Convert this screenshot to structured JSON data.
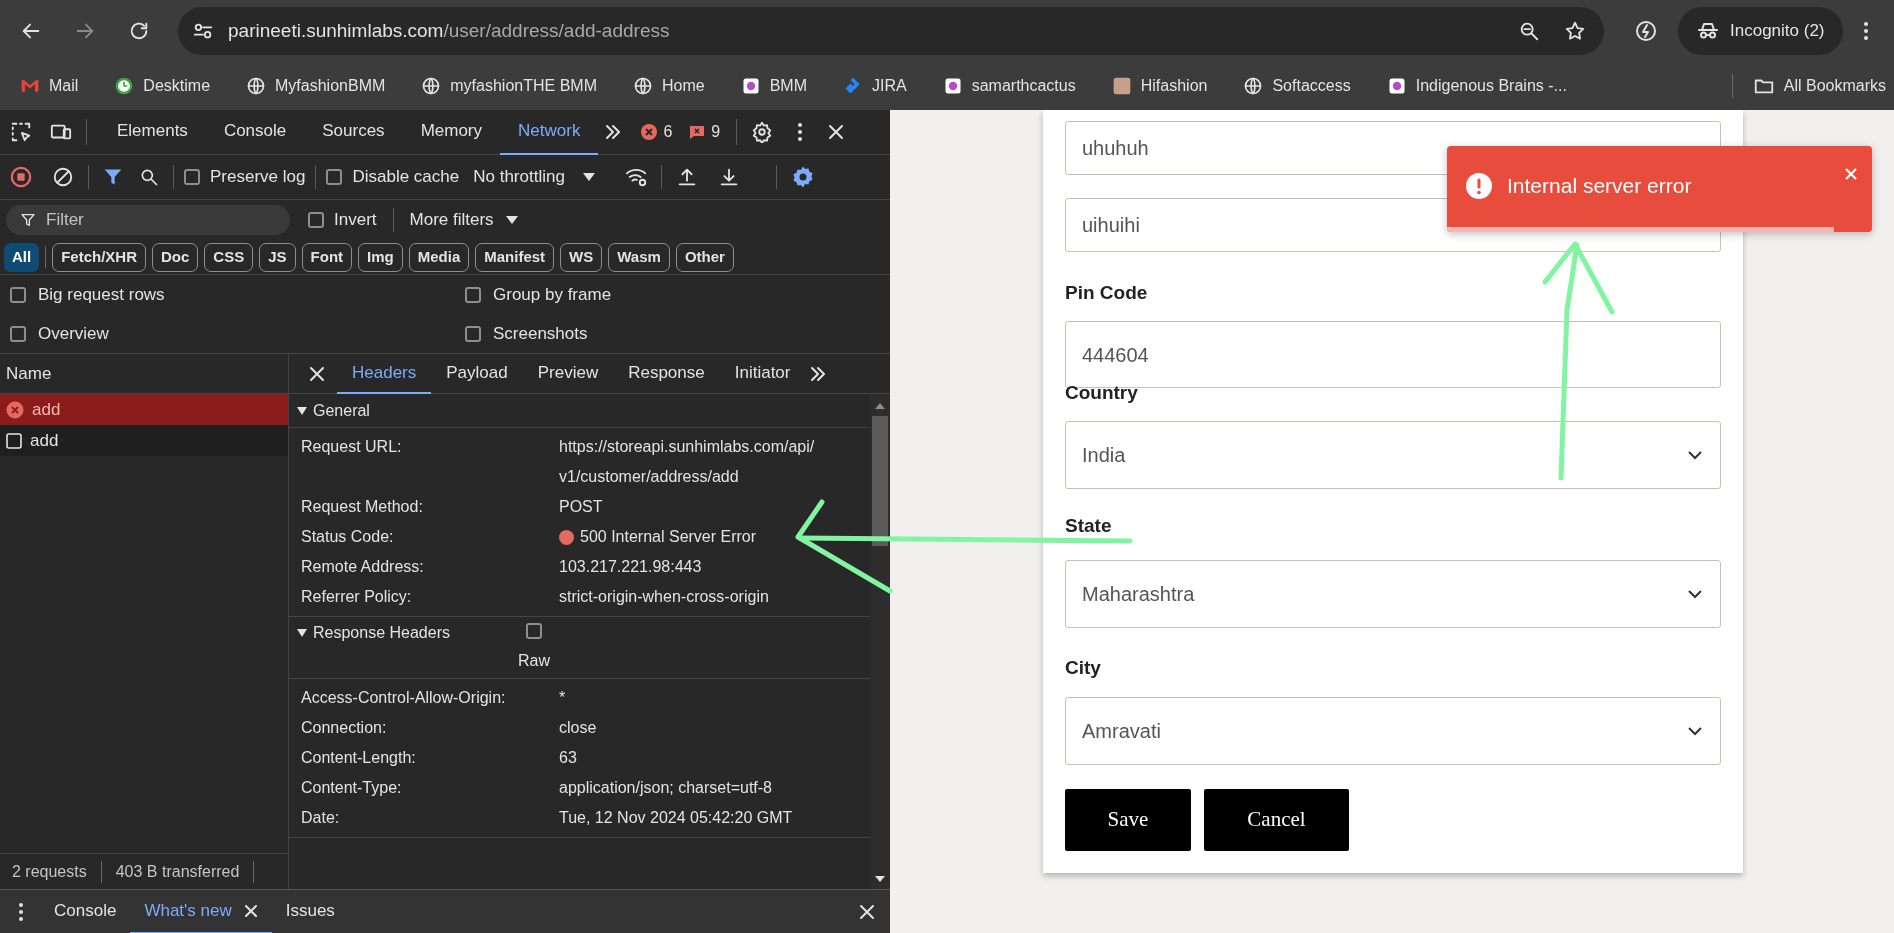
{
  "browser": {
    "url_host": "parineeti.sunhimlabs.com",
    "url_path": "/user/address/add-address",
    "profile": "Incognito (2)",
    "bookmarks": [
      {
        "label": "Mail",
        "kind": "mail"
      },
      {
        "label": "Desktime",
        "kind": "clock"
      },
      {
        "label": "MyfashionBMM",
        "kind": "globe"
      },
      {
        "label": "myfashionTHE BMM",
        "kind": "globe"
      },
      {
        "label": "Home",
        "kind": "globe"
      },
      {
        "label": "BMM",
        "kind": "logo"
      },
      {
        "label": "JIRA",
        "kind": "jira"
      },
      {
        "label": "samarthcactus",
        "kind": "logo"
      },
      {
        "label": "Hifashion",
        "kind": "photo"
      },
      {
        "label": "Softaccess",
        "kind": "globe"
      },
      {
        "label": "Indigenous Brains -...",
        "kind": "logo"
      }
    ],
    "all_bookmarks": "All Bookmarks"
  },
  "devtools": {
    "tabs": [
      {
        "label": "Elements",
        "selected": false
      },
      {
        "label": "Console",
        "selected": false
      },
      {
        "label": "Sources",
        "selected": false
      },
      {
        "label": "Memory",
        "selected": false
      },
      {
        "label": "Network",
        "selected": true
      }
    ],
    "error_count": "6",
    "issue_count": "9",
    "toolbar": {
      "preserve_log": {
        "label": "Preserve log",
        "checked": false
      },
      "disable_cache": {
        "label": "Disable cache",
        "checked": false
      },
      "throttling": "No throttling"
    },
    "filter": {
      "placeholder": "Filter"
    },
    "invert": {
      "label": "Invert",
      "checked": false
    },
    "more_filters": "More filters",
    "type_filters": [
      {
        "label": "All",
        "selected": true
      },
      {
        "label": "Fetch/XHR",
        "selected": false
      },
      {
        "label": "Doc",
        "selected": false
      },
      {
        "label": "CSS",
        "selected": false
      },
      {
        "label": "JS",
        "selected": false
      },
      {
        "label": "Font",
        "selected": false
      },
      {
        "label": "Img",
        "selected": false
      },
      {
        "label": "Media",
        "selected": false
      },
      {
        "label": "Manifest",
        "selected": false
      },
      {
        "label": "WS",
        "selected": false
      },
      {
        "label": "Wasm",
        "selected": false
      },
      {
        "label": "Other",
        "selected": false
      }
    ],
    "options": [
      {
        "label": "Big request rows",
        "checked": false
      },
      {
        "label": "Group by frame",
        "checked": false
      },
      {
        "label": "Overview",
        "checked": false
      },
      {
        "label": "Screenshots",
        "checked": false
      }
    ],
    "requests": {
      "column": "Name",
      "rows": [
        {
          "name": "add",
          "failed": true,
          "selected": true
        },
        {
          "name": "add",
          "failed": false,
          "selected": false
        }
      ]
    },
    "summary": [
      "2 requests",
      "403 B transferred"
    ],
    "details": {
      "tabs": [
        {
          "label": "Headers",
          "selected": true
        },
        {
          "label": "Payload",
          "selected": false
        },
        {
          "label": "Preview",
          "selected": false
        },
        {
          "label": "Response",
          "selected": false
        },
        {
          "label": "Initiator",
          "selected": false
        }
      ],
      "sections": [
        {
          "title": "General",
          "expanded": true,
          "rows": [
            {
              "key": "Request URL:",
              "value": "https://storeapi.sunhimlabs.com/api/v1/customer/address/add",
              "kind": "text"
            },
            {
              "key": "Request Method:",
              "value": "POST",
              "kind": "text"
            },
            {
              "key": "Status Code:",
              "value": "500 Internal Server Error",
              "kind": "status"
            },
            {
              "key": "Remote Address:",
              "value": "103.217.221.98:443",
              "kind": "text"
            },
            {
              "key": "Referrer Policy:",
              "value": "strict-origin-when-cross-origin",
              "kind": "text"
            }
          ]
        },
        {
          "title": "Response Headers",
          "expanded": true,
          "raw": {
            "label": "Raw",
            "checked": false
          },
          "rows": [
            {
              "key": "Access-Control-Allow-Origin:",
              "value": "*",
              "kind": "text"
            },
            {
              "key": "Connection:",
              "value": "close",
              "kind": "text"
            },
            {
              "key": "Content-Length:",
              "value": "63",
              "kind": "text"
            },
            {
              "key": "Content-Type:",
              "value": "application/json; charset=utf-8",
              "kind": "text"
            },
            {
              "key": "Date:",
              "value": "Tue, 12 Nov 2024 05:42:20 GMT",
              "kind": "text"
            }
          ]
        }
      ]
    },
    "drawer": {
      "tabs": [
        {
          "label": "Console",
          "selected": false,
          "closable": false
        },
        {
          "label": "What's new",
          "selected": true,
          "closable": true
        },
        {
          "label": "Issues",
          "selected": false,
          "closable": false
        }
      ]
    }
  },
  "page": {
    "fields": [
      {
        "kind": "text",
        "value": "uhuhuh"
      },
      {
        "kind": "text",
        "value": "uihuihi"
      },
      {
        "kind": "text",
        "label": "Pin Code",
        "value": "444604"
      },
      {
        "kind": "select",
        "label": "Country",
        "value": "India"
      },
      {
        "kind": "select",
        "label": "State",
        "value": "Maharashtra"
      },
      {
        "kind": "select",
        "label": "City",
        "value": "Amravati"
      }
    ],
    "buttons": [
      "Save",
      "Cancel"
    ],
    "toast": {
      "message": "Internal server error",
      "level": 0.91
    }
  }
}
